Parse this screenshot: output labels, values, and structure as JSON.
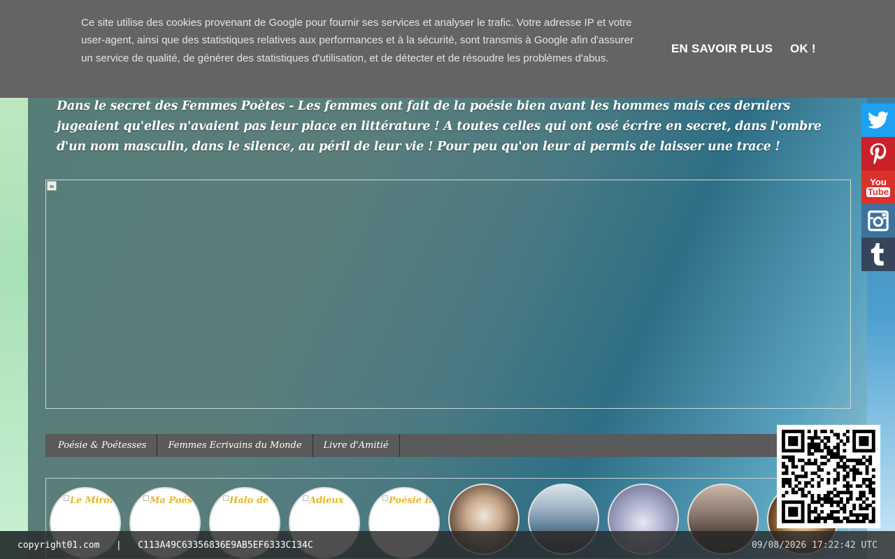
{
  "cookie_banner": {
    "text": "Ce site utilise des cookies provenant de Google pour fournir ses services et analyser le trafic. Votre adresse IP et votre user-agent, ainsi que des statistiques relatives aux performances et à la sécurité, sont transmis à Google afin d'assurer un service de qualité, de générer des statistiques d'utilisation, et de détecter et de résoudre les problèmes d'abus.",
    "learn_more_label": "EN SAVOIR PLUS",
    "ok_label": "OK !"
  },
  "header": {
    "tagline": "Dans le secret des Femmes Poètes - Les femmes ont fait de la poésie bien avant les hommes mais ces derniers jugeaient qu'elles n'avaient pas leur place en littérature ! A toutes celles qui ont osé écrire en secret, dans l'ombre d'un nom masculin, dans le silence, au péril de leur vie ! Pour peu qu'on leur ai permis de laisser une trace !"
  },
  "nav": {
    "items": [
      {
        "label": "Poésie & Poétesses"
      },
      {
        "label": "Femmes Ecrivains du Monde"
      },
      {
        "label": "Livre d'Amitié"
      }
    ]
  },
  "thumbnails": {
    "text_items": [
      {
        "label": "Le Miroir d"
      },
      {
        "label": "Ma Poésie"
      },
      {
        "label": "Halo de Lu"
      },
      {
        "label": "Adieux"
      },
      {
        "label": "Poésie Bou"
      }
    ]
  },
  "social": {
    "icons": [
      "twitter-icon",
      "pinterest-icon",
      "youtube-icon",
      "instagram-icon",
      "tumblr-icon"
    ],
    "colors": {
      "twitter": "#1da1f2",
      "pinterest": "#cb2027",
      "youtube": "#d9322b",
      "instagram": "#3f729b",
      "tumblr": "#35465c"
    },
    "youtube_text_top": "You",
    "youtube_text_bottom": "Tube"
  },
  "footer": {
    "site": "copyright01.com",
    "separator": "|",
    "hash": "C113A49C63356836E9AB5EF6333C134C",
    "timestamp": "09/08/2026 17:22:42 UTC"
  }
}
